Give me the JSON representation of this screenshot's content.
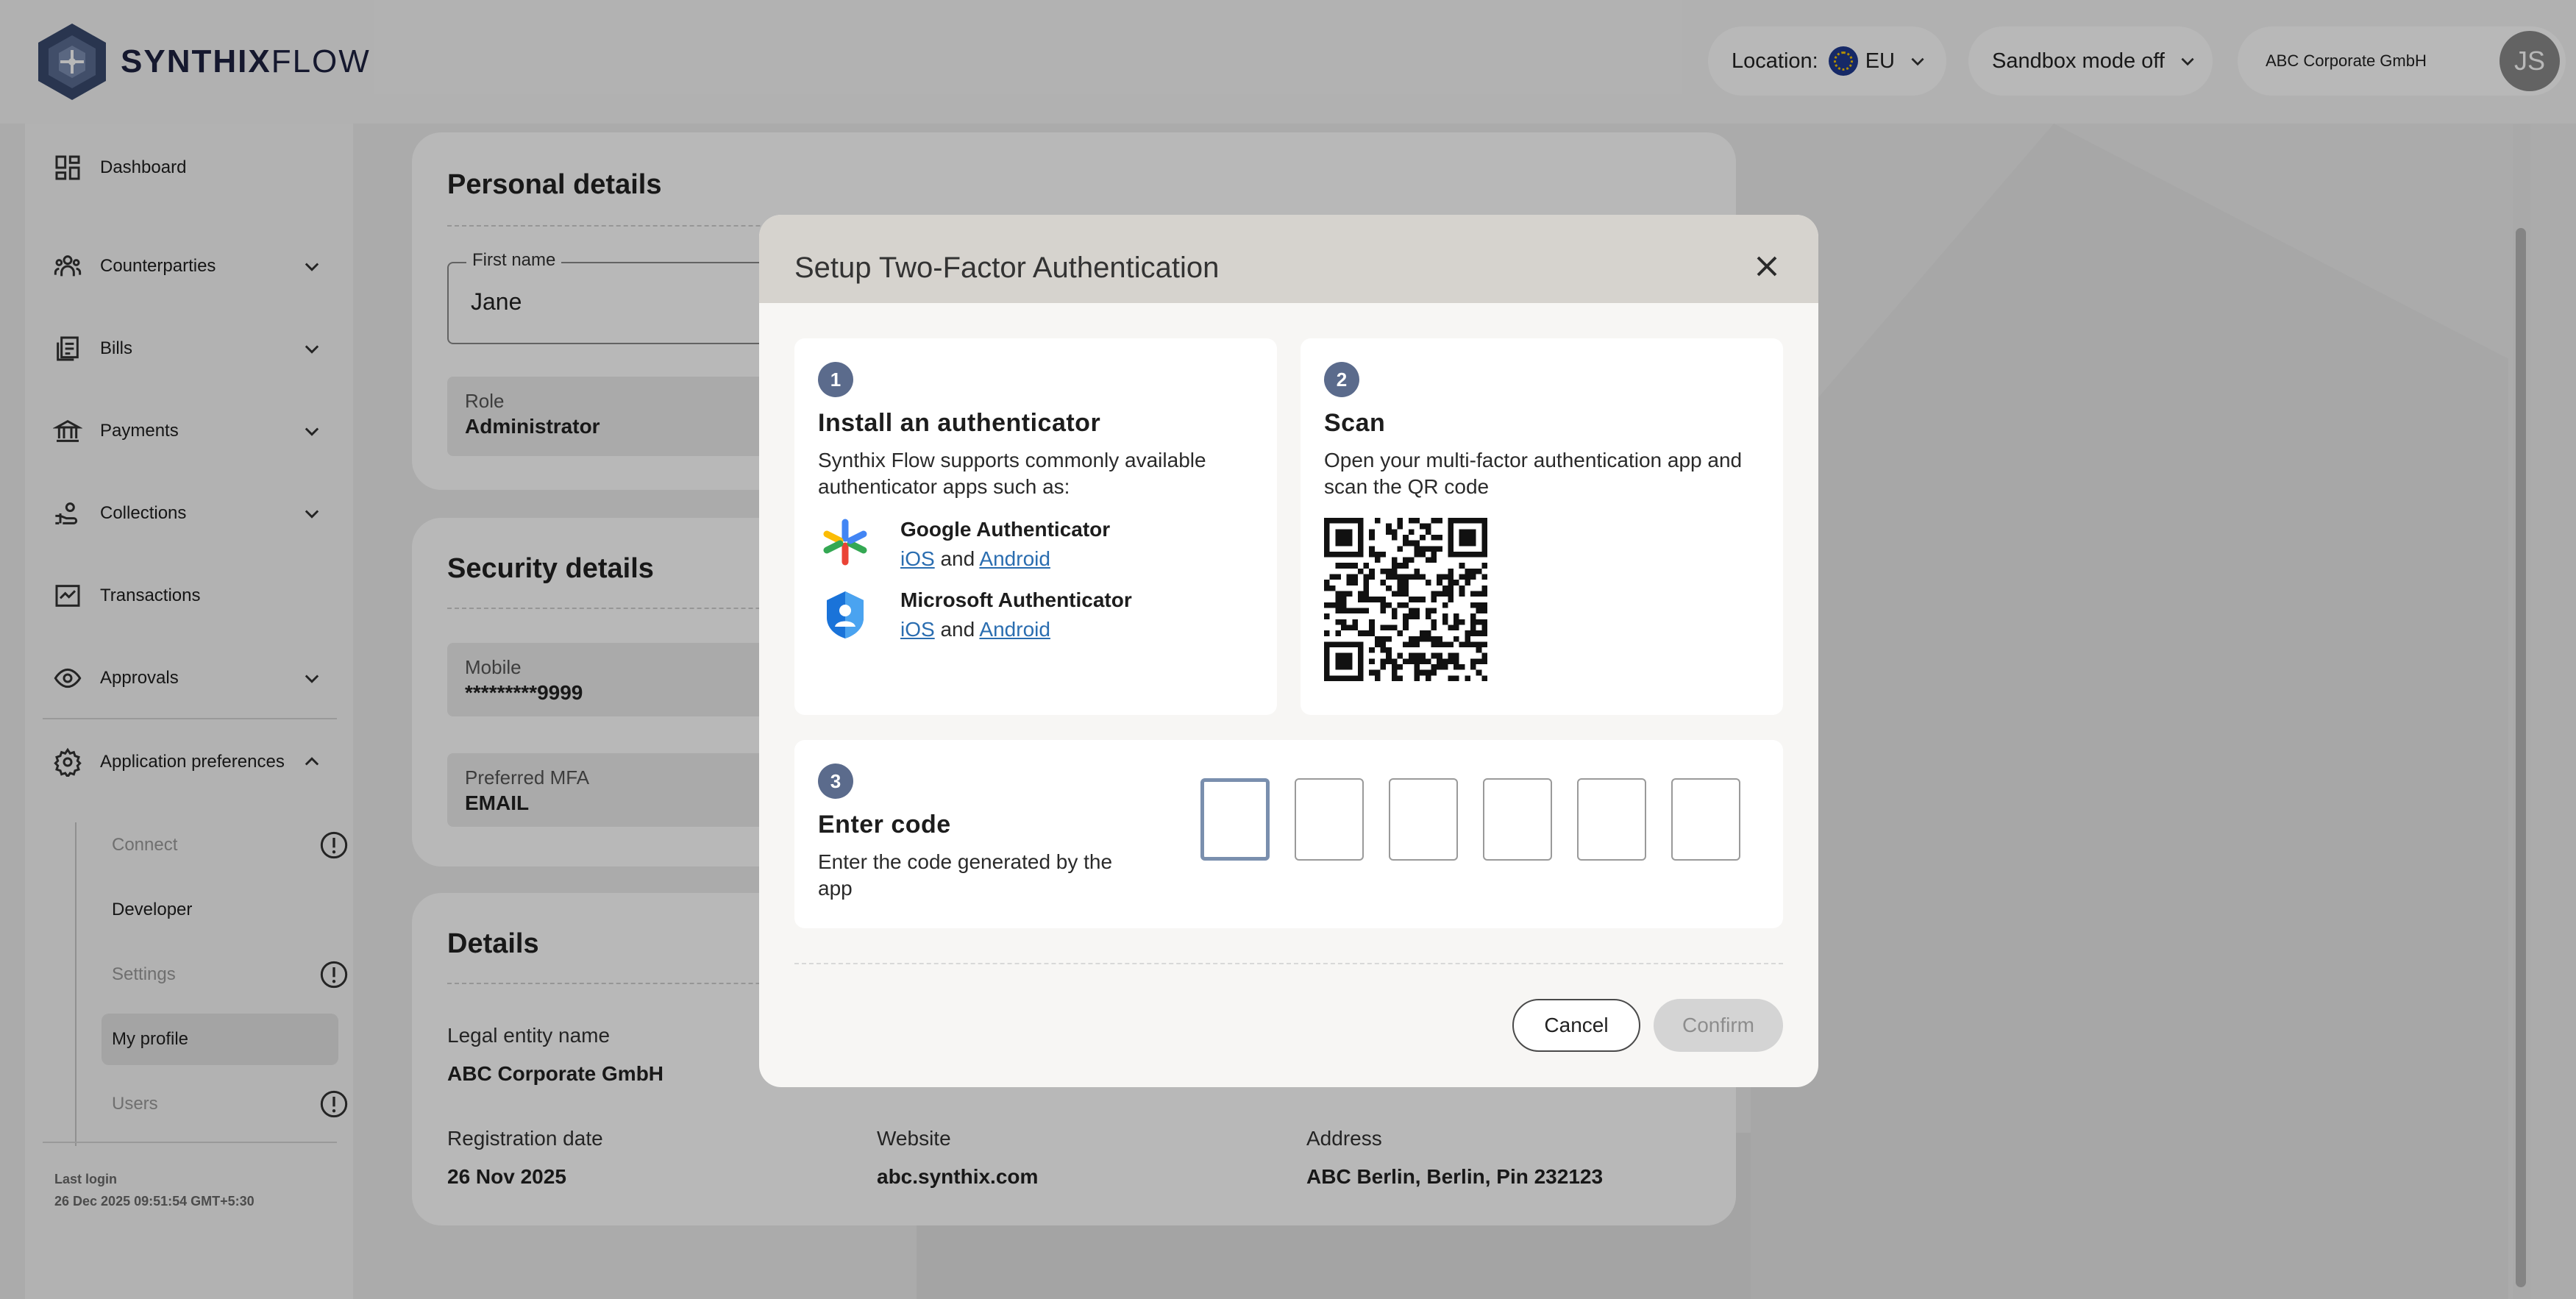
{
  "header": {
    "logo_bold": "SYNTHIX",
    "logo_light": "FLOW",
    "location_label": "Location:",
    "location_value": "EU",
    "sandbox_label": "Sandbox mode off",
    "company": "ABC Corporate GmbH",
    "avatar_initials": "JS"
  },
  "sidebar": {
    "items": [
      {
        "label": "Dashboard",
        "icon": "dashboard-icon"
      },
      {
        "label": "Counterparties",
        "icon": "people-icon"
      },
      {
        "label": "Bills",
        "icon": "bills-icon"
      },
      {
        "label": "Payments",
        "icon": "bank-icon"
      },
      {
        "label": "Collections",
        "icon": "collections-icon"
      },
      {
        "label": "Transactions",
        "icon": "transactions-icon"
      },
      {
        "label": "Approvals",
        "icon": "eye-icon"
      },
      {
        "label": "Application preferences",
        "icon": "gear-icon"
      }
    ],
    "sub_items": [
      {
        "label": "Connect"
      },
      {
        "label": "Developer"
      },
      {
        "label": "Settings"
      },
      {
        "label": "My profile"
      },
      {
        "label": "Users"
      }
    ],
    "last_login_label": "Last login",
    "last_login_value": "26 Dec 2025 09:51:54 GMT+5:30"
  },
  "personal": {
    "title": "Personal details",
    "first_name_label": "First name",
    "first_name_value": "Jane",
    "role_label": "Role",
    "role_value": "Administrator"
  },
  "security": {
    "title": "Security details",
    "mobile_label": "Mobile",
    "mobile_value": "*********9999",
    "mfa_label": "Preferred MFA",
    "mfa_value": "EMAIL"
  },
  "details": {
    "title": "Details",
    "legal_label": "Legal entity name",
    "legal_value": "ABC Corporate GmbH",
    "reg_label": "Registration date",
    "reg_value": "26 Nov 2025",
    "website_label": "Website",
    "website_value": "abc.synthix.com",
    "address_label": "Address",
    "address_value": "ABC Berlin, Berlin, Pin 232123"
  },
  "modal": {
    "title": "Setup Two-Factor Authentication",
    "step1": {
      "number": "1",
      "heading": "Install an authenticator",
      "text": "Synthix Flow supports commonly available authenticator apps such as:",
      "apps": [
        {
          "name": "Google Authenticator",
          "ios": "iOS",
          "and": "and",
          "android": "Android"
        },
        {
          "name": "Microsoft Authenticator",
          "ios": "iOS",
          "and": "and",
          "android": "Android"
        }
      ]
    },
    "step2": {
      "number": "2",
      "heading": "Scan",
      "text": "Open your multi-factor authentication app and scan the QR code"
    },
    "step3": {
      "number": "3",
      "heading": "Enter code",
      "text": "Enter the code generated by the app"
    },
    "cancel_label": "Cancel",
    "confirm_label": "Confirm"
  },
  "colors": {
    "step_badge": "#5b6b8c",
    "link": "#2a6db0",
    "modal_header": "#d6d3ce"
  }
}
